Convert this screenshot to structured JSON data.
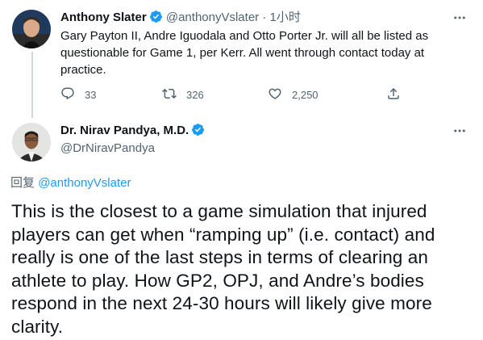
{
  "parent_tweet": {
    "author_name": "Anthony Slater",
    "handle": "@anthonyVslater",
    "separator": "·",
    "time": "1小时",
    "text": "Gary Payton II, Andre Iguodala and Otto Porter Jr. will all be listed as questionable for Game 1, per Kerr. All went through contact today at practice.",
    "replies": "33",
    "retweets": "326",
    "likes": "2,250"
  },
  "main_tweet": {
    "author_name": "Dr. Nirav Pandya, M.D.",
    "handle": "@DrNiravPandya",
    "replying_prefix": "回复",
    "replying_to": "@anthonyVslater",
    "text": "This is the closest to a game simulation that injured players can get when “ramping up” (i.e. contact) and really is one of the last steps in terms of clearing an athlete to play. How GP2, OPJ, and Andre’s bodies respond in the next 24-30 hours will likely give more clarity."
  },
  "colors": {
    "accent": "#1d9bf0",
    "secondary_text": "#536471",
    "primary_text": "#0f1419",
    "thread_line": "#cfd9de"
  },
  "icons": [
    "avatar",
    "verified-badge-icon",
    "more-icon",
    "reply-icon",
    "retweet-icon",
    "like-icon",
    "share-icon"
  ]
}
